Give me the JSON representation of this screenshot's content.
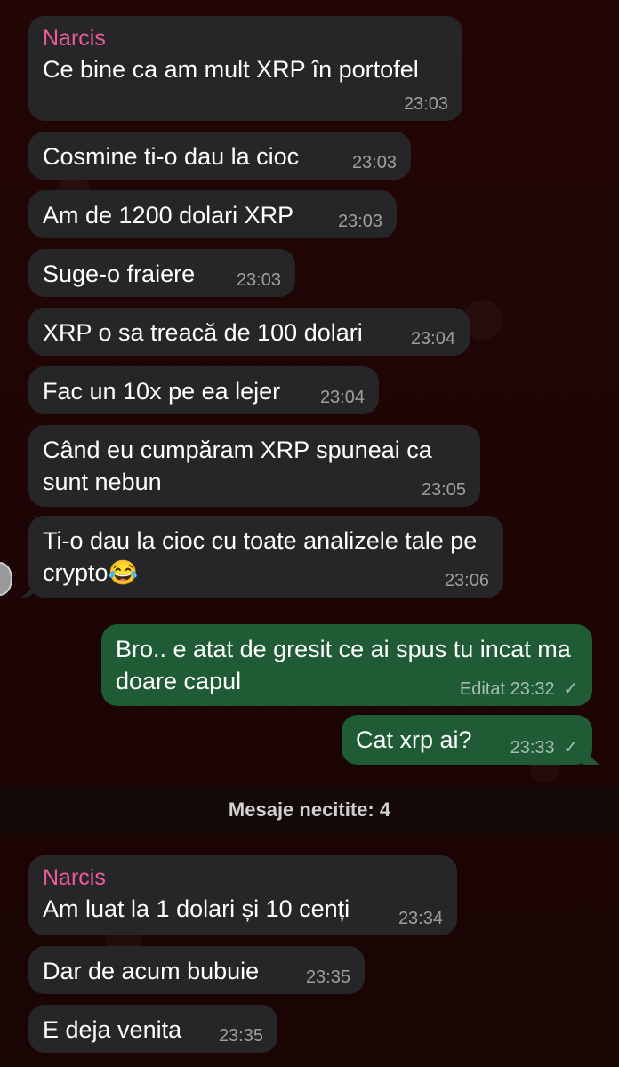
{
  "messages_before": [
    {
      "sender": "Narcis",
      "text": "Ce bine ca am mult XRP în portofel",
      "time": "23:03"
    },
    {
      "text": "Cosmine ti-o dau la cioc",
      "time": "23:03"
    },
    {
      "text": "Am de 1200 dolari XRP",
      "time": "23:03"
    },
    {
      "text": "Suge-o fraiere",
      "time": "23:03"
    },
    {
      "text": "XRP o sa treacă de 100 dolari",
      "time": "23:04"
    },
    {
      "text": "Fac un 10x pe ea lejer",
      "time": "23:04"
    },
    {
      "text": "Când eu cumpăram XRP spuneai ca sunt nebun",
      "time": "23:05"
    },
    {
      "text": "Ti-o dau la cioc cu toate analizele tale pe crypto😂",
      "time": "23:06"
    }
  ],
  "outgoing": [
    {
      "text": "Bro.. e atat de gresit ce ai spus tu incat ma doare capul",
      "edited": "Editat",
      "time": "23:32",
      "status": "✓"
    },
    {
      "text": "Cat xrp ai?",
      "time": "23:33",
      "status": "✓"
    }
  ],
  "unread_label": "Mesaje necitite: 4",
  "messages_after": [
    {
      "sender": "Narcis",
      "text": "Am luat la 1 dolari și 10 cenți",
      "time": "23:34"
    },
    {
      "text": "Dar de acum bubuie",
      "time": "23:35"
    },
    {
      "text": "E deja venita",
      "time": "23:35"
    }
  ],
  "colors": {
    "incoming": "#262628",
    "outgoing": "#1f5b35",
    "sender": "#ec5b92",
    "background": "#1c0505"
  }
}
